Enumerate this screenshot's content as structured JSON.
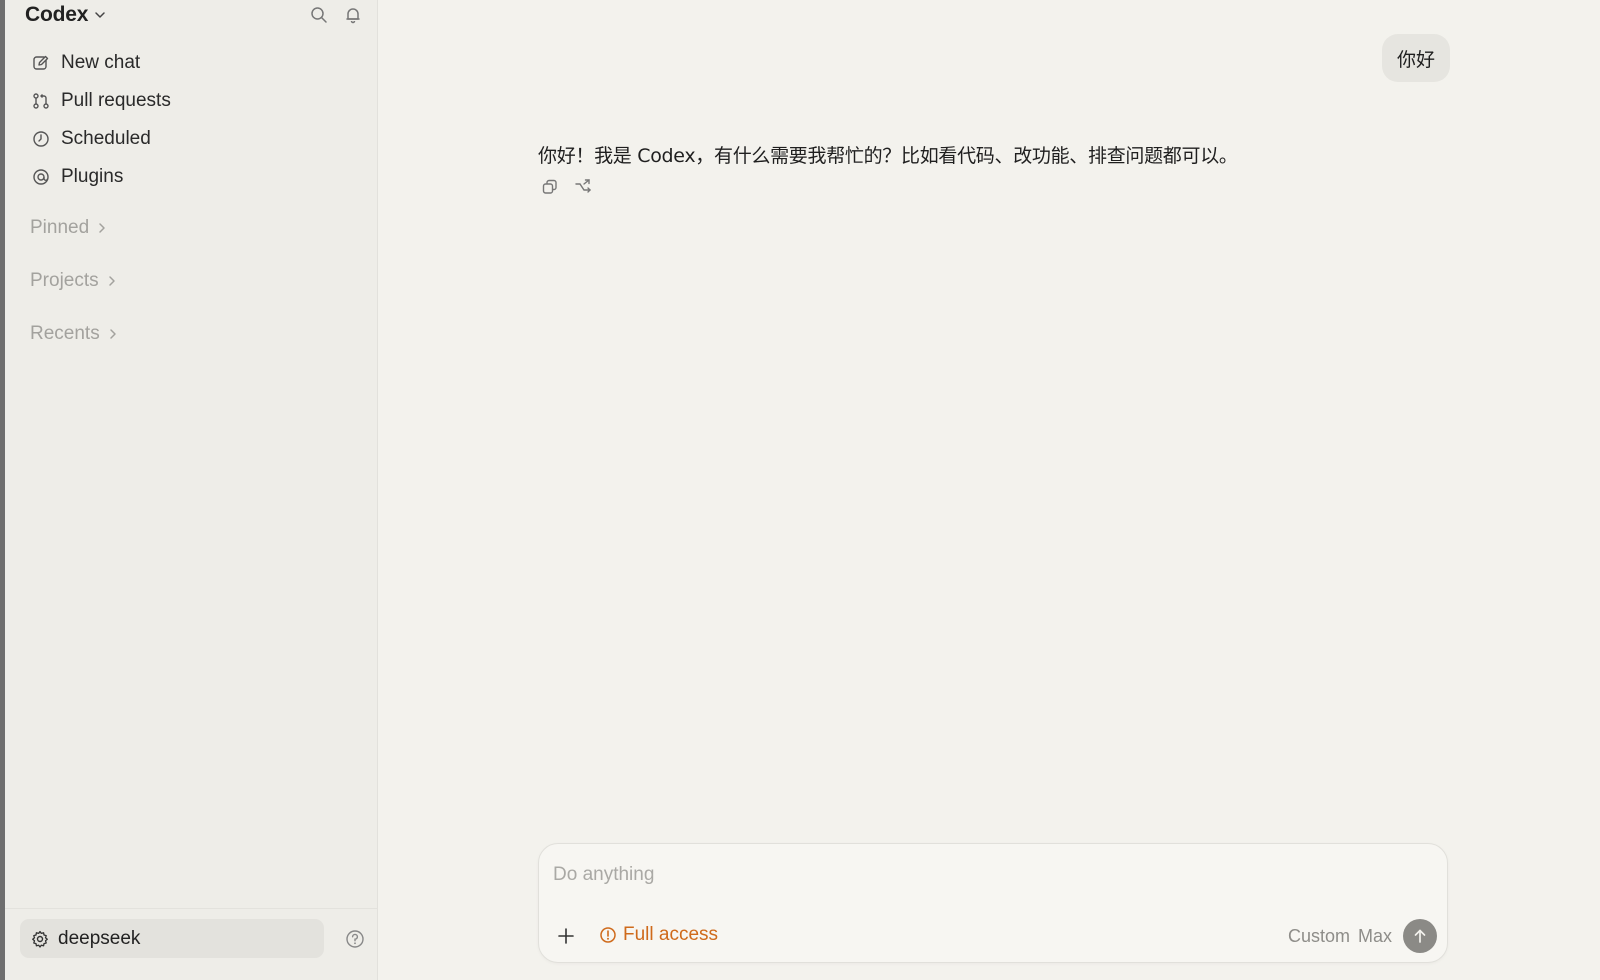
{
  "sidebar": {
    "app_title": "Codex",
    "nav": [
      {
        "label": "New chat",
        "icon": "edit-icon"
      },
      {
        "label": "Pull requests",
        "icon": "pull-request-icon"
      },
      {
        "label": "Scheduled",
        "icon": "clock-icon"
      },
      {
        "label": "Plugins",
        "icon": "plugin-icon"
      }
    ],
    "sections": [
      {
        "label": "Pinned"
      },
      {
        "label": "Projects"
      },
      {
        "label": "Recents"
      }
    ],
    "profile": {
      "label": "deepseek",
      "icon": "settings-icon"
    }
  },
  "chat": {
    "user_message": "你好",
    "assistant_message": "你好！我是 Codex，有什么需要我帮忙的？比如看代码、改功能、排查问题都可以。"
  },
  "composer": {
    "placeholder": "Do anything",
    "access_label": "Full access",
    "model_label": "Custom",
    "effort_label": "Max"
  },
  "colors": {
    "accent_orange": "#cf6a1b",
    "sidebar_bg": "#eeede8",
    "main_bg": "#f3f2ed",
    "send_button": "#8b8a86"
  }
}
